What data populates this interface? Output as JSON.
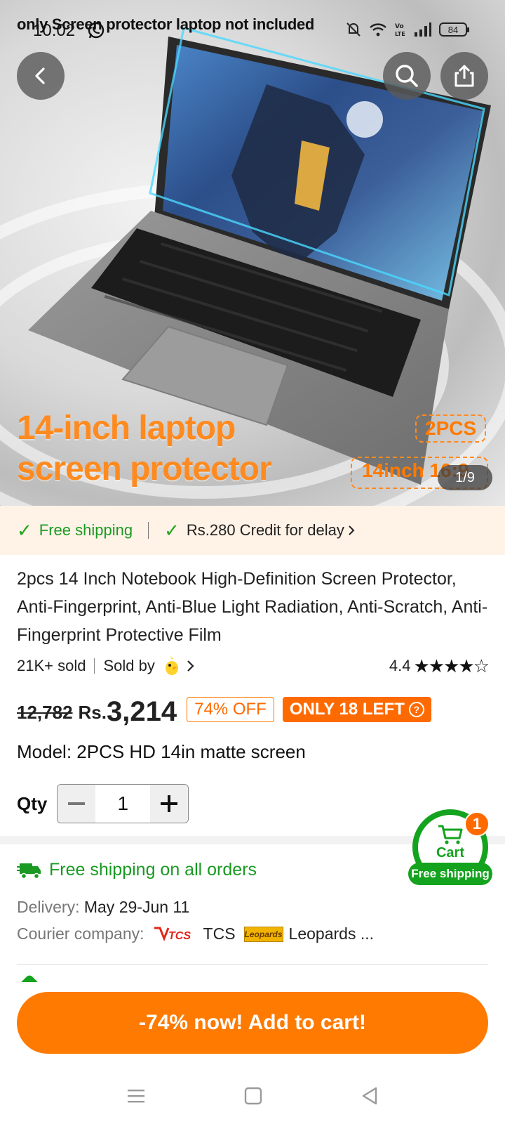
{
  "status_bar": {
    "time": "10:02",
    "battery": "84"
  },
  "hero": {
    "banner_text": "only Screen protector laptop not included",
    "title_line1": "14-inch laptop",
    "title_line2": "screen protector",
    "tag_pcs": "2PCS",
    "tag_size": "14inch  16:9",
    "counter": "1/9"
  },
  "shipping_strip": {
    "free_shipping": "Free shipping",
    "credit": "Rs.280 Credit for delay"
  },
  "product": {
    "title": "2pcs 14 Inch Notebook High-Definition Screen Protector, Anti-Fingerprint, Anti-Blue Light Radiation, Anti-Scratch, Anti-Fingerprint Protective Film",
    "sold": "21K+ sold",
    "sold_by": "Sold by",
    "rating": "4.4",
    "rating_value": 4.4,
    "original_price": "12,782",
    "currency": "Rs.",
    "price": "3,214",
    "discount": "74% OFF",
    "stock": "ONLY 18 LEFT",
    "model": "Model: 2PCS HD 14in matte screen"
  },
  "quantity": {
    "label": "Qty",
    "value": "1"
  },
  "cart_float": {
    "label": "Cart",
    "count": "1",
    "shipping": "Free shipping"
  },
  "shipping_info": {
    "heading": "Free shipping on all orders",
    "delivery_label": "Delivery:",
    "delivery_value": "May 29-Jun 11",
    "courier_label": "Courier company:",
    "courier_1": "TCS",
    "courier_2": "Leopards ...",
    "courier_1_logo": "TCS",
    "courier_2_logo": "Leopards"
  },
  "cta": {
    "label": "-74% now! Add to cart!"
  },
  "colors": {
    "accent": "#ff7a00",
    "green": "#14a31e",
    "strip_bg": "#fff2e6"
  }
}
